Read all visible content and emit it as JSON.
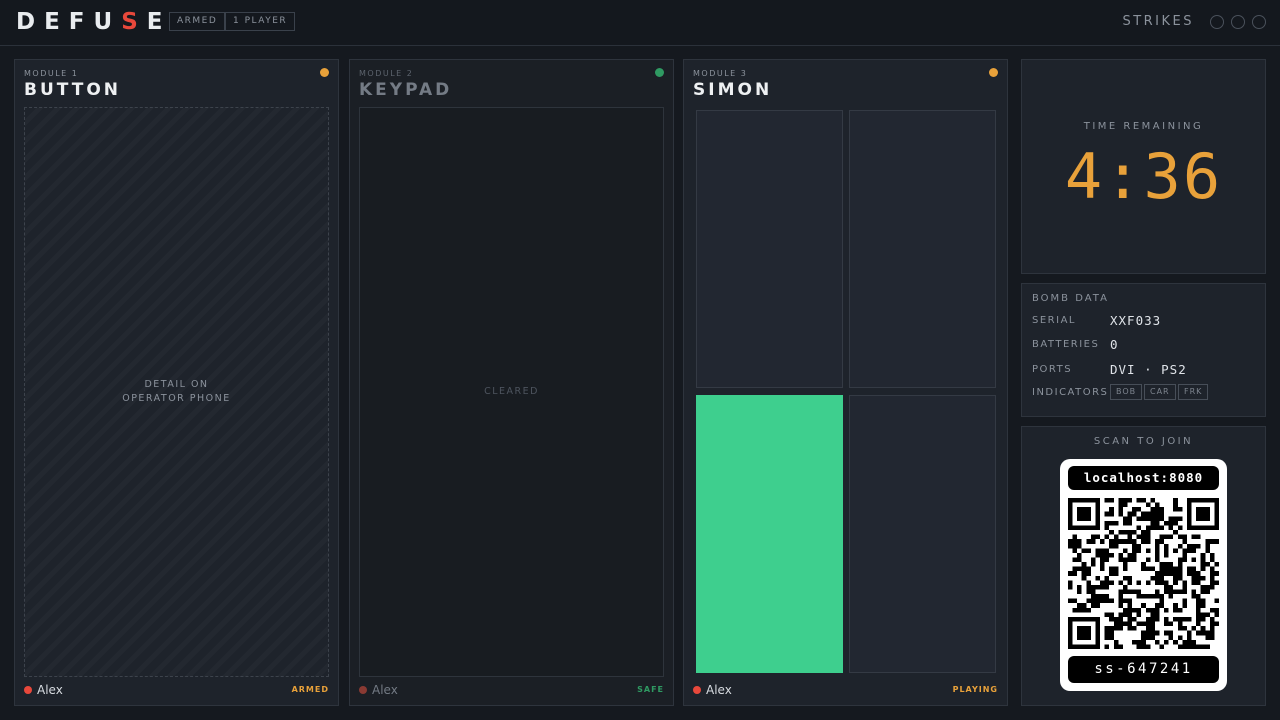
{
  "header": {
    "logo": {
      "before": "DEF",
      "middle_1": "U",
      "accent": "S",
      "after": "E"
    },
    "chips": [
      "ARMED",
      "1 PLAYER"
    ],
    "strikes_label": "STRIKES",
    "strikes": {
      "count": 0,
      "max": 3
    }
  },
  "modules": [
    {
      "number": "MODULE 1",
      "title": "BUTTON",
      "status_color": "#e8a13a",
      "message": "DETAIL ON\nOPERATOR PHONE",
      "player": "Alex",
      "state": "ARMED",
      "state_color": "#e8a13a"
    },
    {
      "number": "MODULE 2",
      "title": "KEYPAD",
      "status_color": "#2f9a62",
      "message": "CLEARED",
      "player": "Alex",
      "state": "SAFE",
      "state_color": "#2f9a62"
    },
    {
      "number": "MODULE 3",
      "title": "SIMON",
      "status_color": "#e8a13a",
      "lit_square": "bottom-left",
      "lit_color": "#3ecf8e",
      "player": "Alex",
      "state": "PLAYING",
      "state_color": "#e8a13a"
    }
  ],
  "timer": {
    "label": "TIME REMAINING",
    "value": "4:36",
    "color": "#e8a13a"
  },
  "bomb_data": {
    "title": "BOMB DATA",
    "serial_label": "SERIAL",
    "serial": "XXF033",
    "batteries_label": "BATTERIES",
    "batteries": "0",
    "ports_label": "PORTS",
    "ports": "DVI · PS2",
    "indicators_label": "INDICATORS",
    "indicators": [
      "BOB",
      "CAR",
      "FRK"
    ]
  },
  "join": {
    "label": "SCAN TO JOIN",
    "host": "localhost:8080",
    "session_code": "ss-647241"
  }
}
